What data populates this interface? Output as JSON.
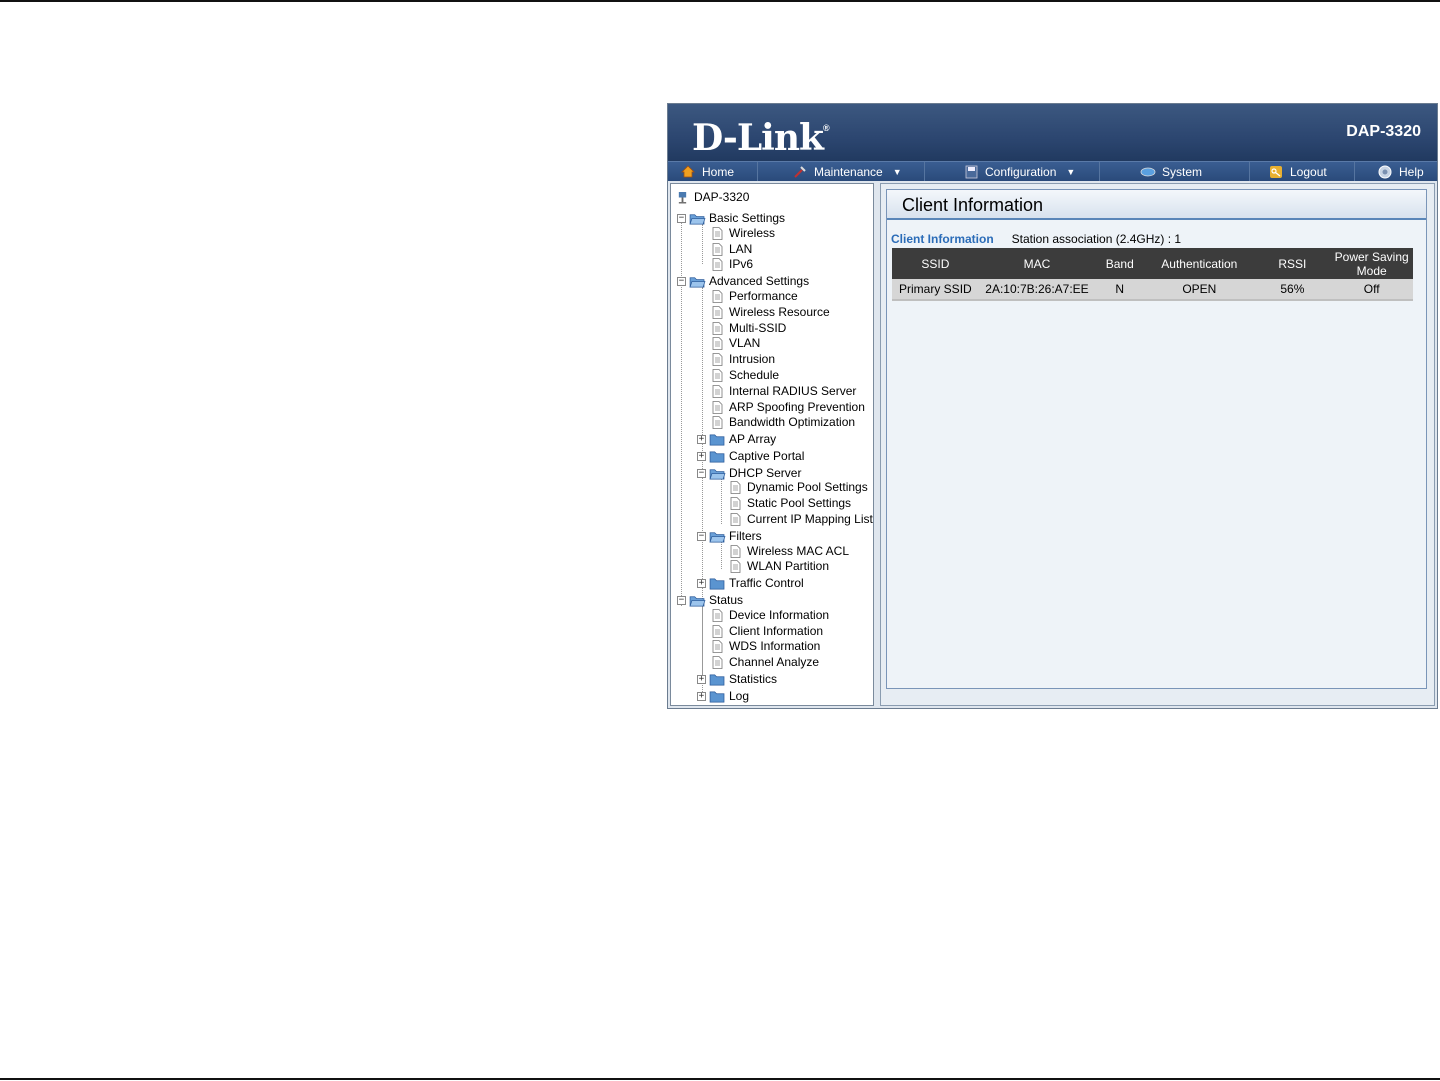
{
  "brand": {
    "logo": "D-Link",
    "registered": "®",
    "model": "DAP-3320"
  },
  "nav": [
    {
      "label": "Home",
      "icon": "home-icon"
    },
    {
      "label": "Maintenance",
      "icon": "tools-icon",
      "dropdown": true
    },
    {
      "label": "Configuration",
      "icon": "save-disk-icon",
      "dropdown": true
    },
    {
      "label": "System",
      "icon": "globe-icon"
    },
    {
      "label": "Logout",
      "icon": "key-icon"
    },
    {
      "label": "Help",
      "icon": "help-icon"
    }
  ],
  "tree": {
    "root": "DAP-3320",
    "basic": {
      "label": "Basic Settings",
      "items": [
        "Wireless",
        "LAN",
        "IPv6"
      ]
    },
    "advanced": {
      "label": "Advanced Settings",
      "items": [
        "Performance",
        "Wireless Resource",
        "Multi-SSID",
        "VLAN",
        "Intrusion",
        "Schedule",
        "Internal RADIUS Server",
        "ARP Spoofing Prevention",
        "Bandwidth Optimization"
      ],
      "ap_array": "AP Array",
      "captive_portal": "Captive Portal",
      "dhcp": {
        "label": "DHCP Server",
        "items": [
          "Dynamic Pool Settings",
          "Static Pool Settings",
          "Current IP Mapping List"
        ]
      },
      "filters": {
        "label": "Filters",
        "items": [
          "Wireless MAC ACL",
          "WLAN Partition"
        ]
      },
      "traffic_control": "Traffic Control"
    },
    "status": {
      "label": "Status",
      "items": [
        "Device Information",
        "Client Information",
        "WDS Information",
        "Channel Analyze"
      ],
      "statistics": "Statistics",
      "log": "Log"
    }
  },
  "main": {
    "title": "Client Information",
    "section_link": "Client Information",
    "station_label": "Station association (2.4GHz) :",
    "station_count": "1",
    "columns": [
      "SSID",
      "MAC",
      "Band",
      "Authentication",
      "RSSI",
      "Power Saving Mode"
    ],
    "rows": [
      [
        "Primary SSID",
        "2A:10:7B:26:A7:EE",
        "N",
        "OPEN",
        "56%",
        "Off"
      ]
    ]
  },
  "colors": {
    "header": "#2c4670",
    "navbar": "#2a4a7a",
    "accent_link": "#2b6cb8",
    "table_header": "#3c3c3c"
  }
}
